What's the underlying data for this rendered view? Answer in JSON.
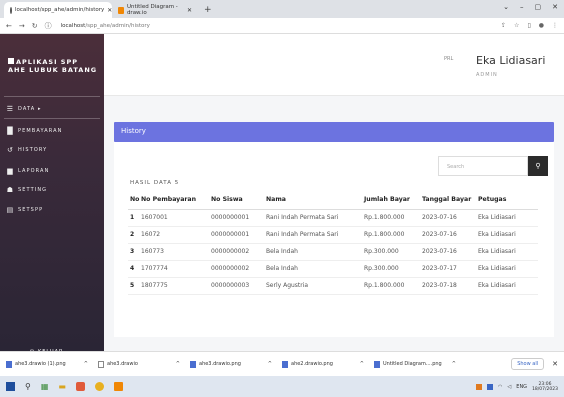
{
  "browser": {
    "tabs": [
      {
        "label": "localhost/spp_ahe/admin/history"
      },
      {
        "label": "Untitled Diagram - draw.io"
      }
    ],
    "url_host": "localhost",
    "url_path": "/spp_ahe/admin/history"
  },
  "sidebar": {
    "brand": "APLIKASI SPP AHE LUBUK BATANG",
    "items": [
      {
        "label": "DATA ▸",
        "icon": "list-icon"
      },
      {
        "label": "PEMBAYARAN",
        "icon": "square-icon"
      },
      {
        "label": "HISTORY",
        "icon": "history-icon"
      },
      {
        "label": "LAPORAN",
        "icon": "report-icon"
      },
      {
        "label": "SETTING",
        "icon": "user-cog-icon"
      },
      {
        "label": "SETSPP",
        "icon": "card-icon"
      }
    ],
    "logout": "KELUAR"
  },
  "header": {
    "avatar_alt": "PRL",
    "username": "Eka Lidiasari",
    "role": "ADMIN"
  },
  "card": {
    "title": "History",
    "search_placeholder": "Search",
    "count_label": "HASIL DATA 5",
    "columns": [
      "No",
      "No Pembayaran",
      "No Siswa",
      "Nama",
      "Jumlah Bayar",
      "Tanggal Bayar",
      "Petugas"
    ],
    "rows": [
      [
        "1",
        "1607001",
        "0000000001",
        "Rani Indah Permata Sari",
        "Rp.1.800.000",
        "2023-07-16",
        "Eka Lidiasari"
      ],
      [
        "2",
        "16072",
        "0000000001",
        "Rani Indah Permata Sari",
        "Rp.1.800.000",
        "2023-07-16",
        "Eka Lidiasari"
      ],
      [
        "3",
        "160773",
        "0000000002",
        "Bela Indah",
        "Rp.300.000",
        "2023-07-16",
        "Eka Lidiasari"
      ],
      [
        "4",
        "1707774",
        "0000000002",
        "Bela Indah",
        "Rp.300.000",
        "2023-07-17",
        "Eka Lidiasari"
      ],
      [
        "5",
        "1807775",
        "0000000003",
        "Serly Agustria",
        "Rp.1.800.000",
        "2023-07-18",
        "Eka Lidiasari"
      ]
    ]
  },
  "downloads": {
    "items": [
      "ahe3.drawio (1).png",
      "ahe3.drawio",
      "ahe3.drawio.png",
      "ahe2.drawio.png",
      "Untitled Diagram....png"
    ],
    "show_all": "Show all"
  },
  "taskbar": {
    "lang": "ENG",
    "time": "23:06",
    "date": "18/07/2023"
  },
  "colors": {
    "card_header": "#6c73e0",
    "sidebar_top": "#4b2e3a",
    "search_button": "#2b2b2b"
  }
}
